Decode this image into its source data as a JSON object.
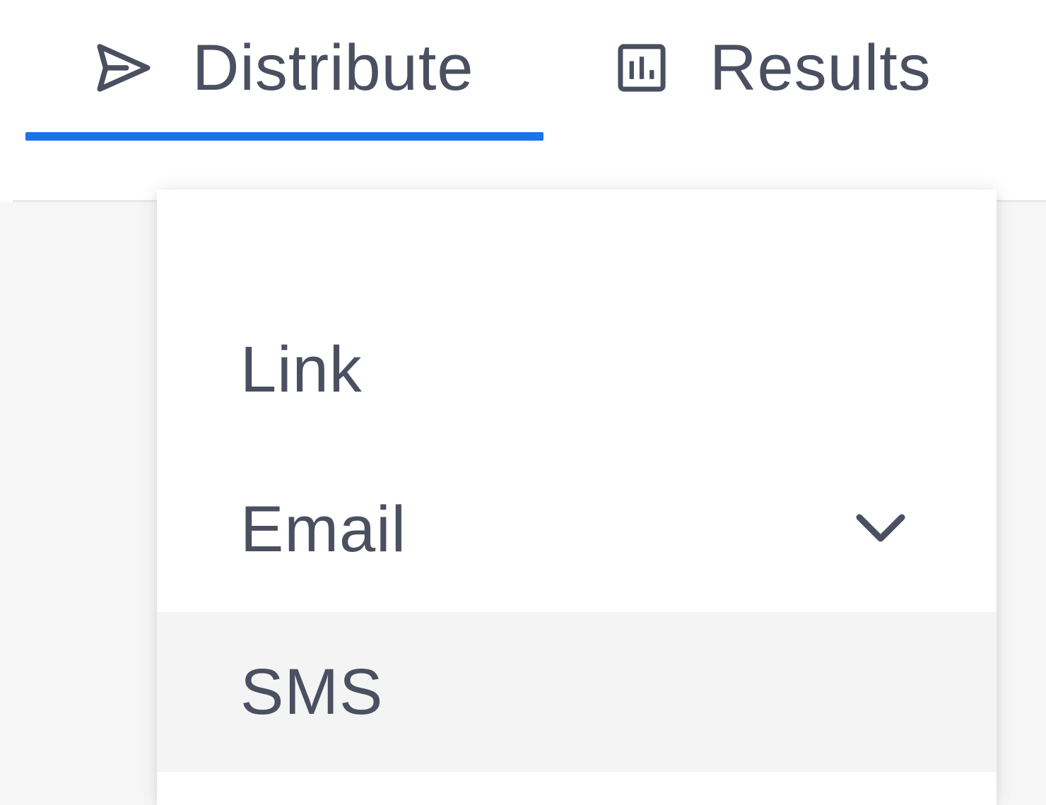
{
  "tabs": {
    "distribute": {
      "label": "Distribute",
      "icon": "send-icon",
      "active": true
    },
    "results": {
      "label": "Results",
      "icon": "bar-chart-icon",
      "active": false
    }
  },
  "menu": {
    "items": [
      {
        "label": "Link",
        "expandable": false
      },
      {
        "label": "Email",
        "expandable": true,
        "expand_icon": "chevron-down-icon"
      },
      {
        "label": "SMS",
        "expandable": false,
        "highlighted": true
      }
    ]
  },
  "colors": {
    "accent": "#1a73e8",
    "text": "#4a5060",
    "hover_background": "#f4f4f5"
  }
}
